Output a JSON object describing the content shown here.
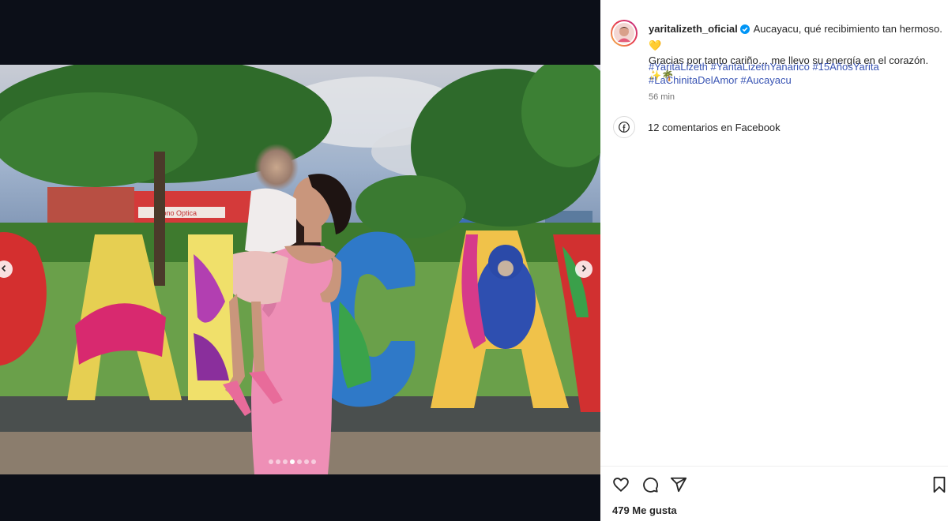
{
  "post": {
    "username": "yaritalizeth_oficial",
    "caption_line1": "Aucayacu, qué recibimiento tan hermoso. 💛",
    "caption_line2": "Gracias por tanto cariño… me llevo su energía en el corazón. ✨🌴",
    "hashtags": [
      "#YaritaLizeth",
      "#YaritaLizethYanarico",
      "#15AñosYarita",
      "#LaChinitaDelAmor",
      "#Aucayacu"
    ],
    "time_ago": "56 min",
    "facebook_comments": "12 comentarios en Facebook",
    "likes": "479 Me gusta"
  },
  "photo": {
    "sign_texts": [
      "Fono Optica"
    ],
    "carousel_total": 7,
    "carousel_active": 4
  },
  "icons": {
    "verified": "verified-badge-icon",
    "prev": "chevron-left-icon",
    "next": "chevron-right-icon",
    "like": "heart-icon",
    "comment": "comment-icon",
    "share": "share-icon",
    "save": "bookmark-icon",
    "facebook": "facebook-icon"
  },
  "colors": {
    "verified": "#0095f6",
    "hashtag": "#3a55b4",
    "media_bg": "#0c0f18"
  }
}
